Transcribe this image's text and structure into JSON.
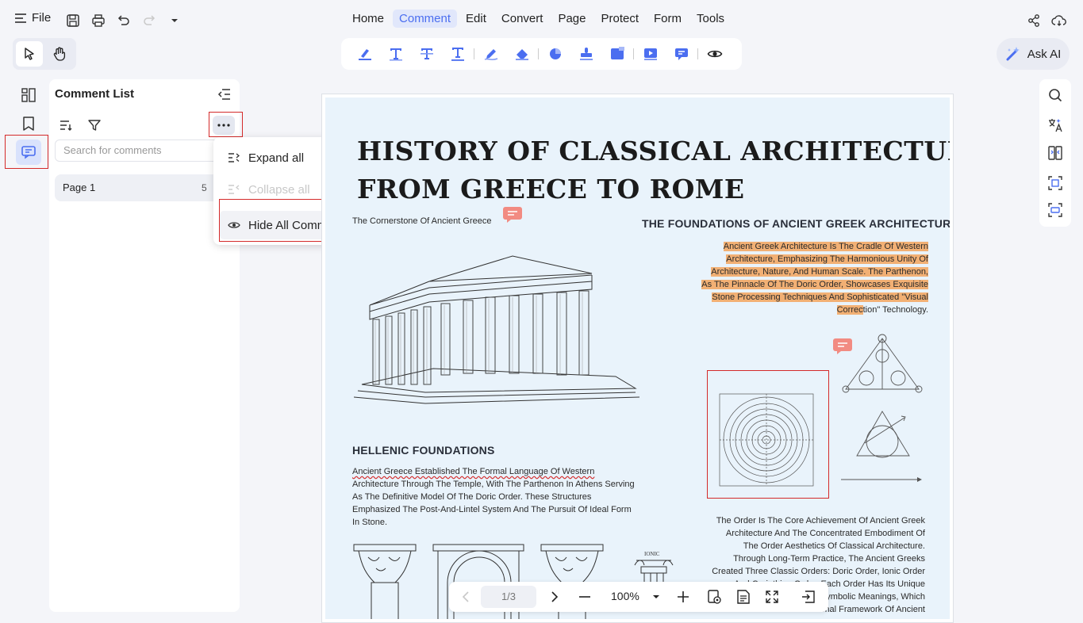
{
  "menubar": {
    "file_label": "File",
    "menus": [
      "Home",
      "Comment",
      "Edit",
      "Convert",
      "Page",
      "Protect",
      "Form",
      "Tools"
    ],
    "active_menu": "Comment"
  },
  "ask_ai": {
    "label": "Ask AI"
  },
  "comment_panel": {
    "title": "Comment List",
    "search_placeholder": "Search for comments",
    "page_label": "Page 1",
    "page_count": "5"
  },
  "dropdown": {
    "expand_all": "Expand all",
    "collapse_all": "Collapse all",
    "hide_all": "Hide All Comments"
  },
  "document": {
    "title_line1": "HISTORY OF CLASSICAL  ARCHITECTURE:",
    "title_line2": "FROM GREECE TO ROME",
    "cornerstone_caption": "The Cornerstone Of Ancient Greece",
    "foundations_heading": "THE FOUNDATIONS OF ANCIENT GREEK ARCHITECTURE",
    "foundations_lines": [
      "Ancient Greek Architecture Is The Cradle Of Western",
      "Architecture, Emphasizing The Harmonious Unity Of",
      "Architecture, Nature, And Human Scale. The Parthenon,",
      "As The Pinnacle Of The Doric Order, Showcases Exquisite",
      "Stone Processing Techniques And Sophisticated \"Visual"
    ],
    "foundations_last_hl": "Correc",
    "foundations_last_rest": "tion\" Technology.",
    "hellenic_heading": "HELLENIC FOUNDATIONS",
    "hellenic_lines": [
      "Ancient Greece Established The Formal Language Of Western",
      "Architecture Through The Temple, With The Parthenon In Athens Serving",
      "As The Definitive Model Of The Doric Order. These Structures",
      "Emphasized The Post-And-Lintel System And The Pursuit Of Ideal Form",
      "In Stone."
    ],
    "order_lines": [
      "The Order Is The Core Achievement Of Ancient Greek",
      "Architecture And The Concentrated Embodiment Of",
      "The Order Aesthetics Of Classical Architecture.",
      "Through Long-Term Practice, The Ancient Greeks",
      "Created Three Classic Orders: Doric Order, Ionic Order",
      "And Corinthian Order. Each Order Has Its Unique",
      "Proportions And Symbolic Meanings, Which",
      "Constitute The Formal Framework Of Ancient"
    ],
    "ionic_label": "IONIC"
  },
  "bottom_nav": {
    "page_indicator": "1/3",
    "zoom": "100%"
  },
  "colors": {
    "accent": "#4b6ef0",
    "highlight": "#f2b074",
    "annotation_red": "#d42a2a",
    "sticky_note": "#f28b82"
  }
}
